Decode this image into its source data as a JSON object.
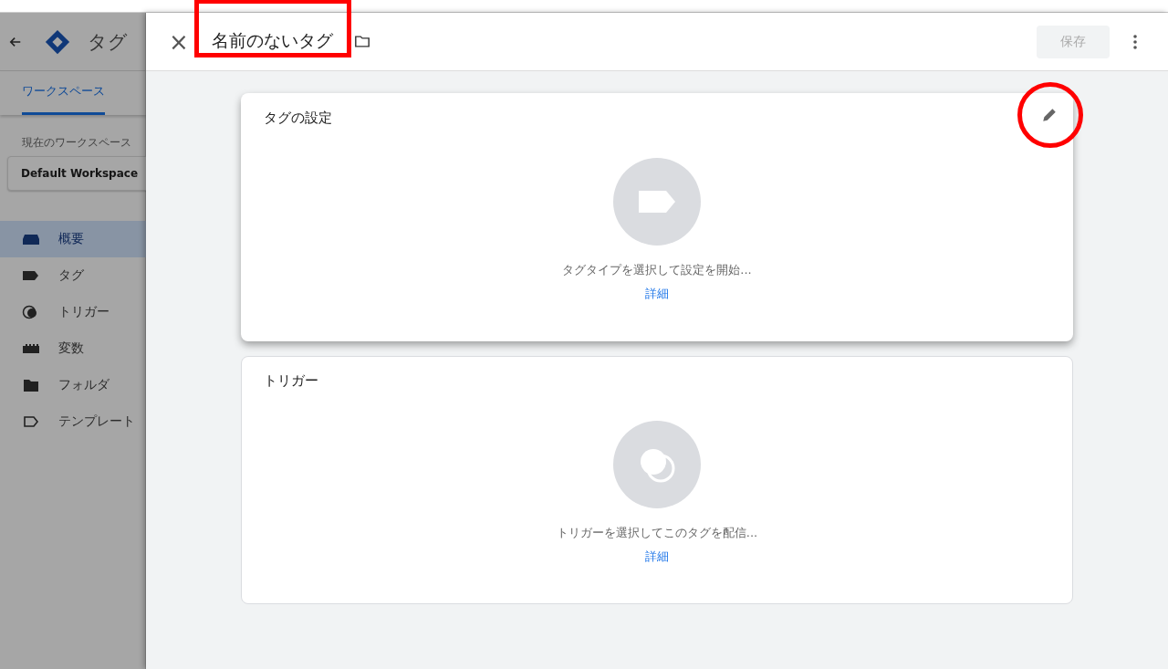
{
  "sidebar": {
    "app_title": "タグ",
    "tabs": [
      {
        "label": "ワークスペース",
        "selected": true
      }
    ],
    "workspace_label": "現在のワークスペース",
    "workspace": "Default Workspace",
    "nav": [
      {
        "label": "概要",
        "kind": "overview",
        "selected": true
      },
      {
        "label": "タグ",
        "kind": "tag",
        "selected": false
      },
      {
        "label": "トリガー",
        "kind": "trigger",
        "selected": false
      },
      {
        "label": "変数",
        "kind": "variable",
        "selected": false
      },
      {
        "label": "フォルダ",
        "kind": "folder",
        "selected": false
      },
      {
        "label": "テンプレート",
        "kind": "template",
        "selected": false
      }
    ]
  },
  "header": {
    "close": "×",
    "name": "名前のないタグ",
    "name_highlighted": true,
    "save": "保存",
    "save_disabled": true
  },
  "cards": [
    {
      "kind": "tag",
      "title": "タグの設定",
      "edit_highlighted": true,
      "prompt": "タグタイプを選択して設定を開始...",
      "link": "詳細",
      "raised": true
    },
    {
      "kind": "trigger",
      "title": "トリガー",
      "prompt": "トリガーを選択してこのタグを配信...",
      "link": "詳細",
      "raised": false
    }
  ]
}
